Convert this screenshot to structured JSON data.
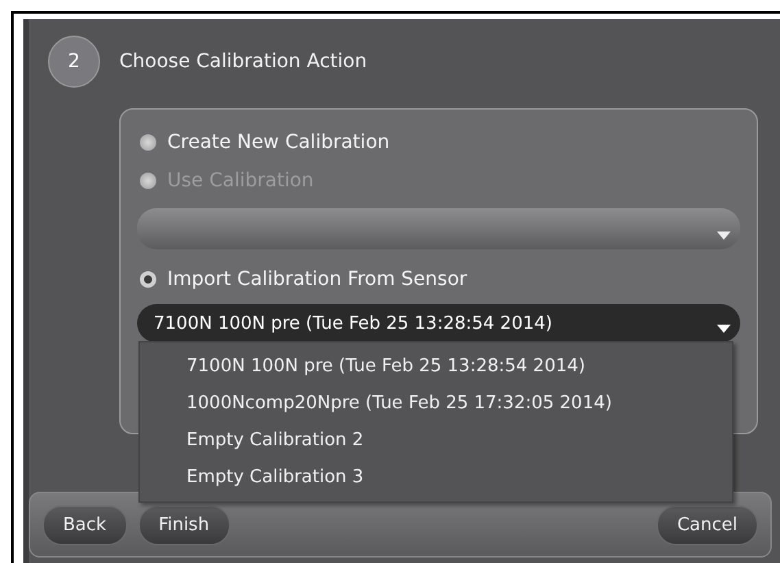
{
  "step": {
    "number": "2",
    "title": "Choose Calibration Action"
  },
  "options": [
    {
      "label": "Create New Calibration",
      "selected": false,
      "disabled": false
    },
    {
      "label": "Use Calibration",
      "selected": false,
      "disabled": true
    },
    {
      "label": "Import Calibration From Sensor",
      "selected": true,
      "disabled": false
    }
  ],
  "sensor_select": {
    "value": "7100N 100N pre (Tue Feb 25 13:28:54 2014)",
    "expanded": true
  },
  "dropdown_items": [
    "7100N 100N pre (Tue Feb 25 13:28:54 2014)",
    "1000Ncomp20Npre (Tue Feb 25 17:32:05 2014)",
    "Empty Calibration 2",
    "Empty Calibration 3"
  ],
  "buttons": {
    "left": [
      "Back",
      "Finish"
    ],
    "right": [
      "Cancel"
    ]
  }
}
